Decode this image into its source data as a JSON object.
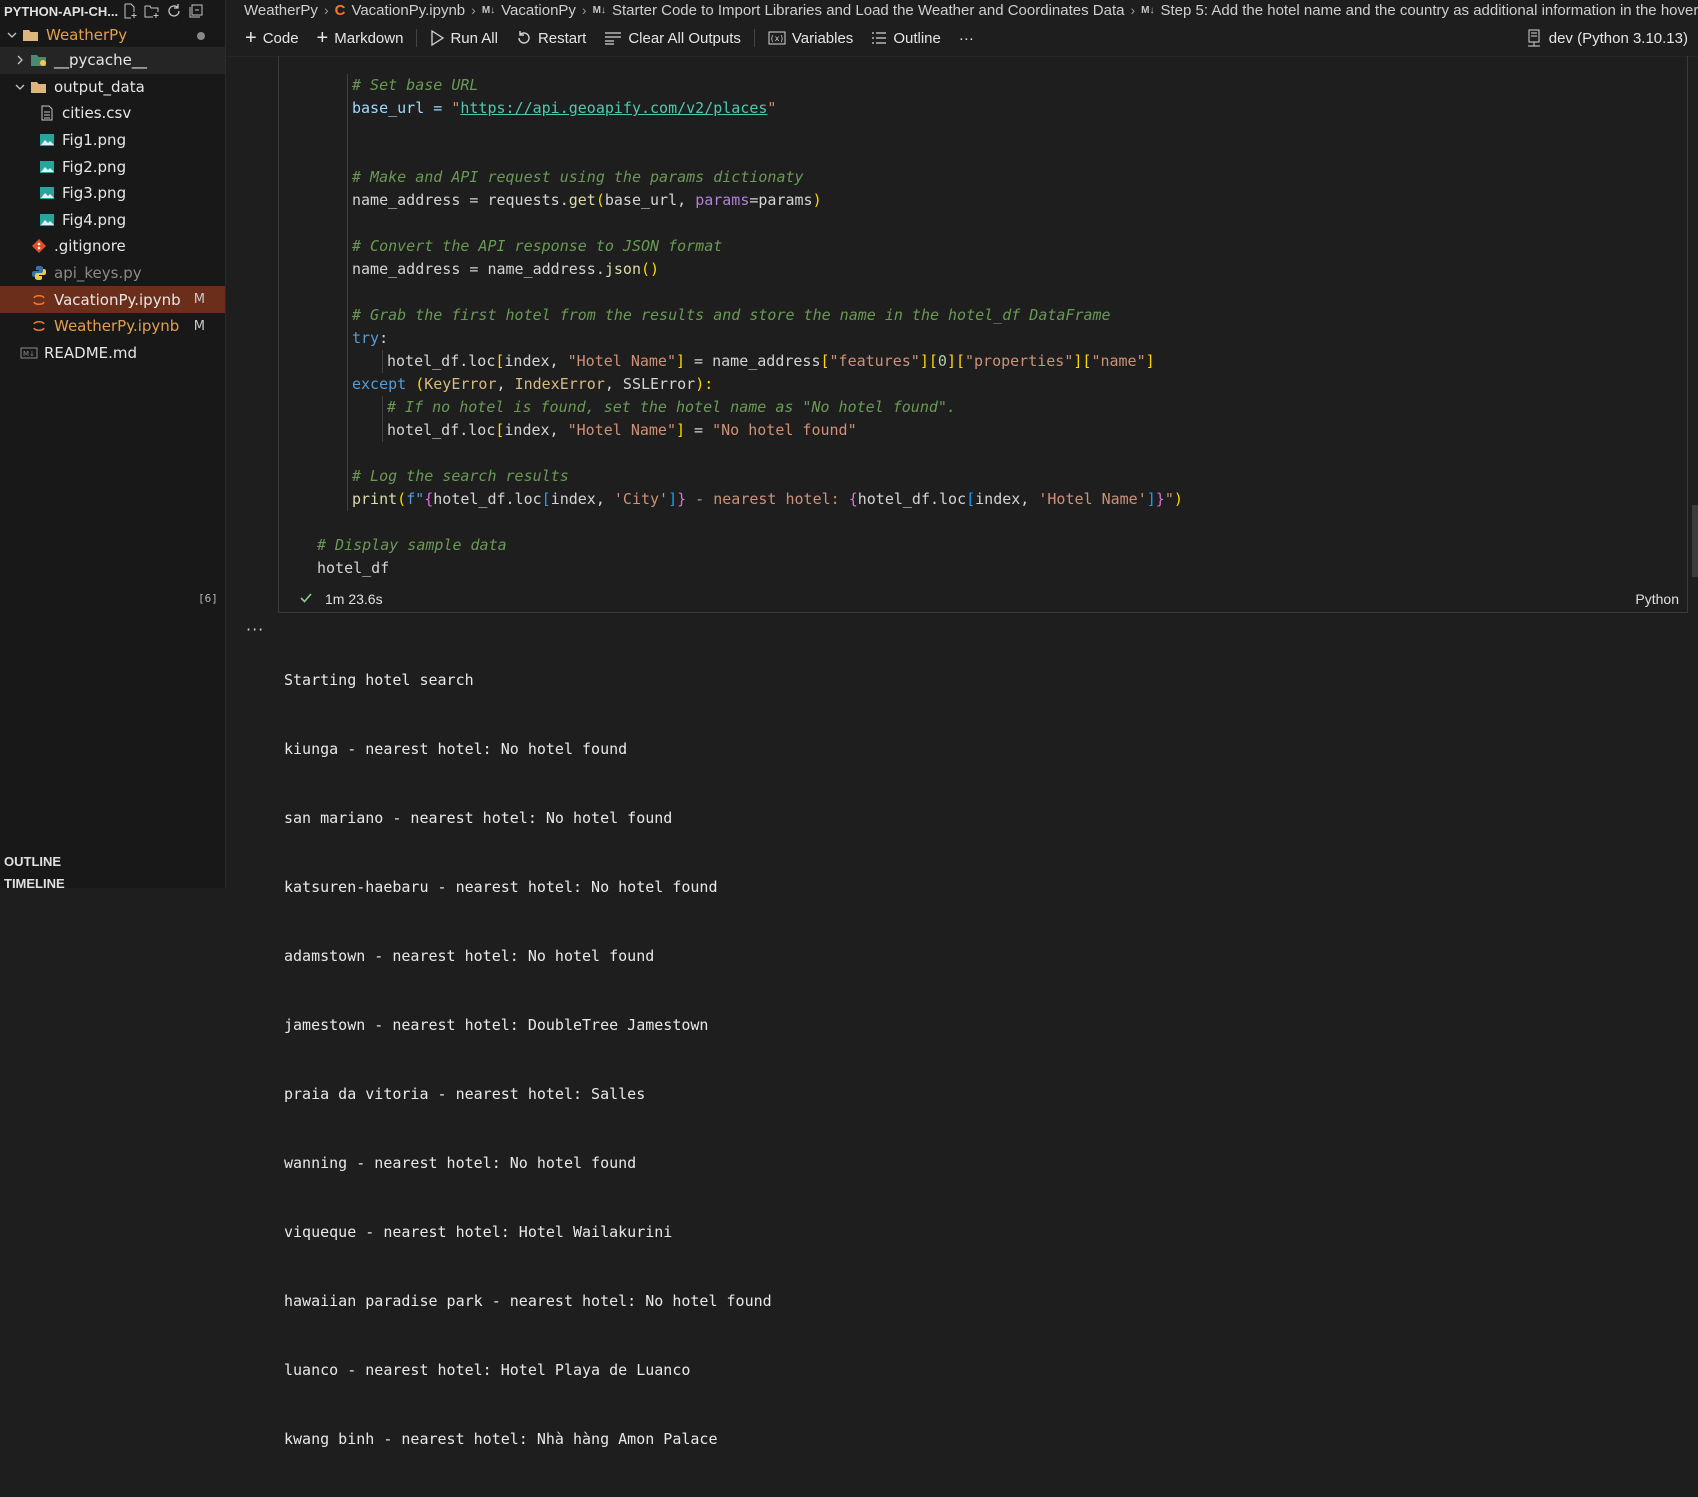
{
  "sidebar": {
    "title": "PYTHON-API-CH...",
    "root": "WeatherPy",
    "items": [
      {
        "label": "__pycache__"
      },
      {
        "label": "output_data"
      },
      {
        "label": "cities.csv"
      },
      {
        "label": "Fig1.png"
      },
      {
        "label": "Fig2.png"
      },
      {
        "label": "Fig3.png"
      },
      {
        "label": "Fig4.png"
      },
      {
        "label": ".gitignore"
      },
      {
        "label": "api_keys.py"
      },
      {
        "label": "VacationPy.ipynb",
        "status": "M"
      },
      {
        "label": "WeatherPy.ipynb",
        "status": "M"
      },
      {
        "label": "README.md"
      }
    ],
    "outline": "OUTLINE",
    "timeline": "TIMELINE"
  },
  "breadcrumb": {
    "items": [
      "WeatherPy",
      "VacationPy.ipynb",
      "VacationPy",
      "Starter Code to Import Libraries and Load the Weather and Coordinates Data",
      "Step 5: Add the hotel name and the country as additional information in the hover"
    ],
    "md_badge": "M↓"
  },
  "toolbar": {
    "code": "Code",
    "markdown": "Markdown",
    "run_all": "Run All",
    "restart": "Restart",
    "clear_outputs": "Clear All Outputs",
    "variables": "Variables",
    "outline": "Outline",
    "more": "···",
    "kernel": "dev (Python 3.10.13)"
  },
  "code": {
    "l1": "# Set base URL",
    "l2a": "base_url = ",
    "l2q": "\"",
    "l2url": "https://api.geoapify.com/v2/places",
    "l3": "# Make and API request using the params dictionaty",
    "l4a": "name_address = requests.",
    "l4fn": "get",
    "l4b": "(",
    "l4c": "base_url, ",
    "l4p": "params",
    "l4d": "=params",
    "l4e": ")",
    "l5": "# Convert the API response to JSON format",
    "l6a": "name_address = name_address.",
    "l6fn": "json",
    "l6b": "()",
    "l7": "# Grab the first hotel from the results and store the name in the hotel_df DataFrame",
    "l8": "try",
    "l8b": ":",
    "l9a": "hotel_df.loc",
    "l9b": "[",
    "l9c": "index, ",
    "l9s1": "\"Hotel Name\"",
    "l9d": "]",
    "l9e": " = name_address",
    "l9f": "[",
    "l9s2": "\"features\"",
    "l9g": "][",
    "l9n": "0",
    "l9h": "][",
    "l9s3": "\"properties\"",
    "l9i": "][",
    "l9s4": "\"name\"",
    "l9j": "]",
    "l10": "except",
    "l10a": " (",
    "l10e1": "KeyError",
    "l10b": ", ",
    "l10e2": "IndexError",
    "l10c": ", SSLError",
    "l10d": "):",
    "l11": "# If no hotel is found, set the hotel name as \"No hotel found\".",
    "l12a": "hotel_df.loc",
    "l12b": "[",
    "l12c": "index, ",
    "l12s1": "\"Hotel Name\"",
    "l12d": "]",
    "l12e": " = ",
    "l12s2": "\"No hotel found\"",
    "l13": "# Log the search results",
    "l14fn": "print",
    "l14a": "(",
    "l14f": "f\"",
    "l14b": "{",
    "l14c": "hotel_df.loc",
    "l14d": "[",
    "l14e": "index, ",
    "l14s1": "'City'",
    "l14g": "]",
    "l14h": "}",
    "l14i": " - nearest hotel: ",
    "l14j": "{",
    "l14k": "hotel_df.loc",
    "l14l": "[",
    "l14m": "index, ",
    "l14s2": "'Hotel Name'",
    "l14n": "]",
    "l14o": "}",
    "l14q": "\"",
    "l14p": ")",
    "l15": "# Display sample data",
    "l16": "hotel_df"
  },
  "cell": {
    "exec_count": "[6]",
    "duration": "1m 23.6s",
    "language": "Python"
  },
  "output": {
    "menu": "···",
    "lines": [
      "Starting hotel search",
      "kiunga - nearest hotel: No hotel found",
      "san mariano - nearest hotel: No hotel found",
      "katsuren-haebaru - nearest hotel: No hotel found",
      "adamstown - nearest hotel: No hotel found",
      "jamestown - nearest hotel: DoubleTree Jamestown",
      "praia da vitoria - nearest hotel: Salles",
      "wanning - nearest hotel: No hotel found",
      "viqueque - nearest hotel: Hotel Wailakurini",
      "hawaiian paradise park - nearest hotel: No hotel found",
      "luanco - nearest hotel: Hotel Playa de Luanco",
      "kwang binh - nearest hotel: Nhà hàng Amon Palace"
    ]
  }
}
